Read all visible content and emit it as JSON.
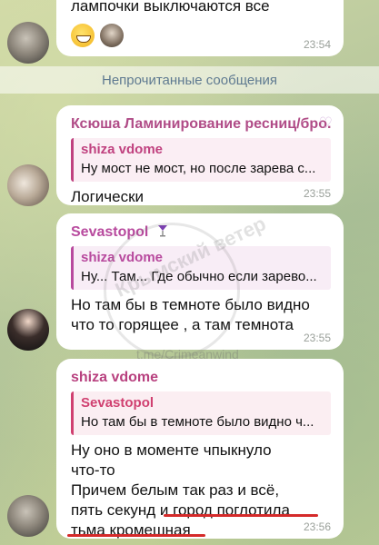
{
  "messages": [
    {
      "text": "лампочки выключаются все",
      "reactions": [
        "grin-emoji-icon",
        "user-avatar"
      ],
      "time": "23:54"
    },
    {
      "sender": "Ксюша Ламинирование ресниц/бро...",
      "sender_color": "#b04c87",
      "reply": {
        "name": "shiza vdome",
        "text": "Ну мост не мост, но после зарева с...",
        "color": "#c0417f"
      },
      "text": "Логически",
      "time": "23:55"
    },
    {
      "sender": "Sevastopol",
      "sender_color": "#b84a9e",
      "reply": {
        "name": "shiza vdome",
        "text": "Ну... Там... Где обычно если зарево...",
        "color": "#b84a9e"
      },
      "text": "Но там бы в темноте было видно что то горящее , а там темнота",
      "time": "23:55"
    },
    {
      "sender": "shiza vdome",
      "sender_color": "#b8417f",
      "reply": {
        "name": "Sevastopol",
        "text": "Но там бы в темноте было видно ч...",
        "color": "#d04070"
      },
      "text_lines": [
        "Ну оно в моменте чпыкнуло",
        "что-то",
        "Причем белым так раз и всё,",
        "пять секунд и город поглотила",
        "тьма кромешная"
      ],
      "time": "23:56"
    }
  ],
  "unread_label": "Непрочитанные сообщения",
  "watermark": {
    "text": "Крымский ветер",
    "link": "t.me/Crimeanwind"
  },
  "colors": {
    "underline": "#d52a2a",
    "unread_text": "#5f7a91"
  }
}
